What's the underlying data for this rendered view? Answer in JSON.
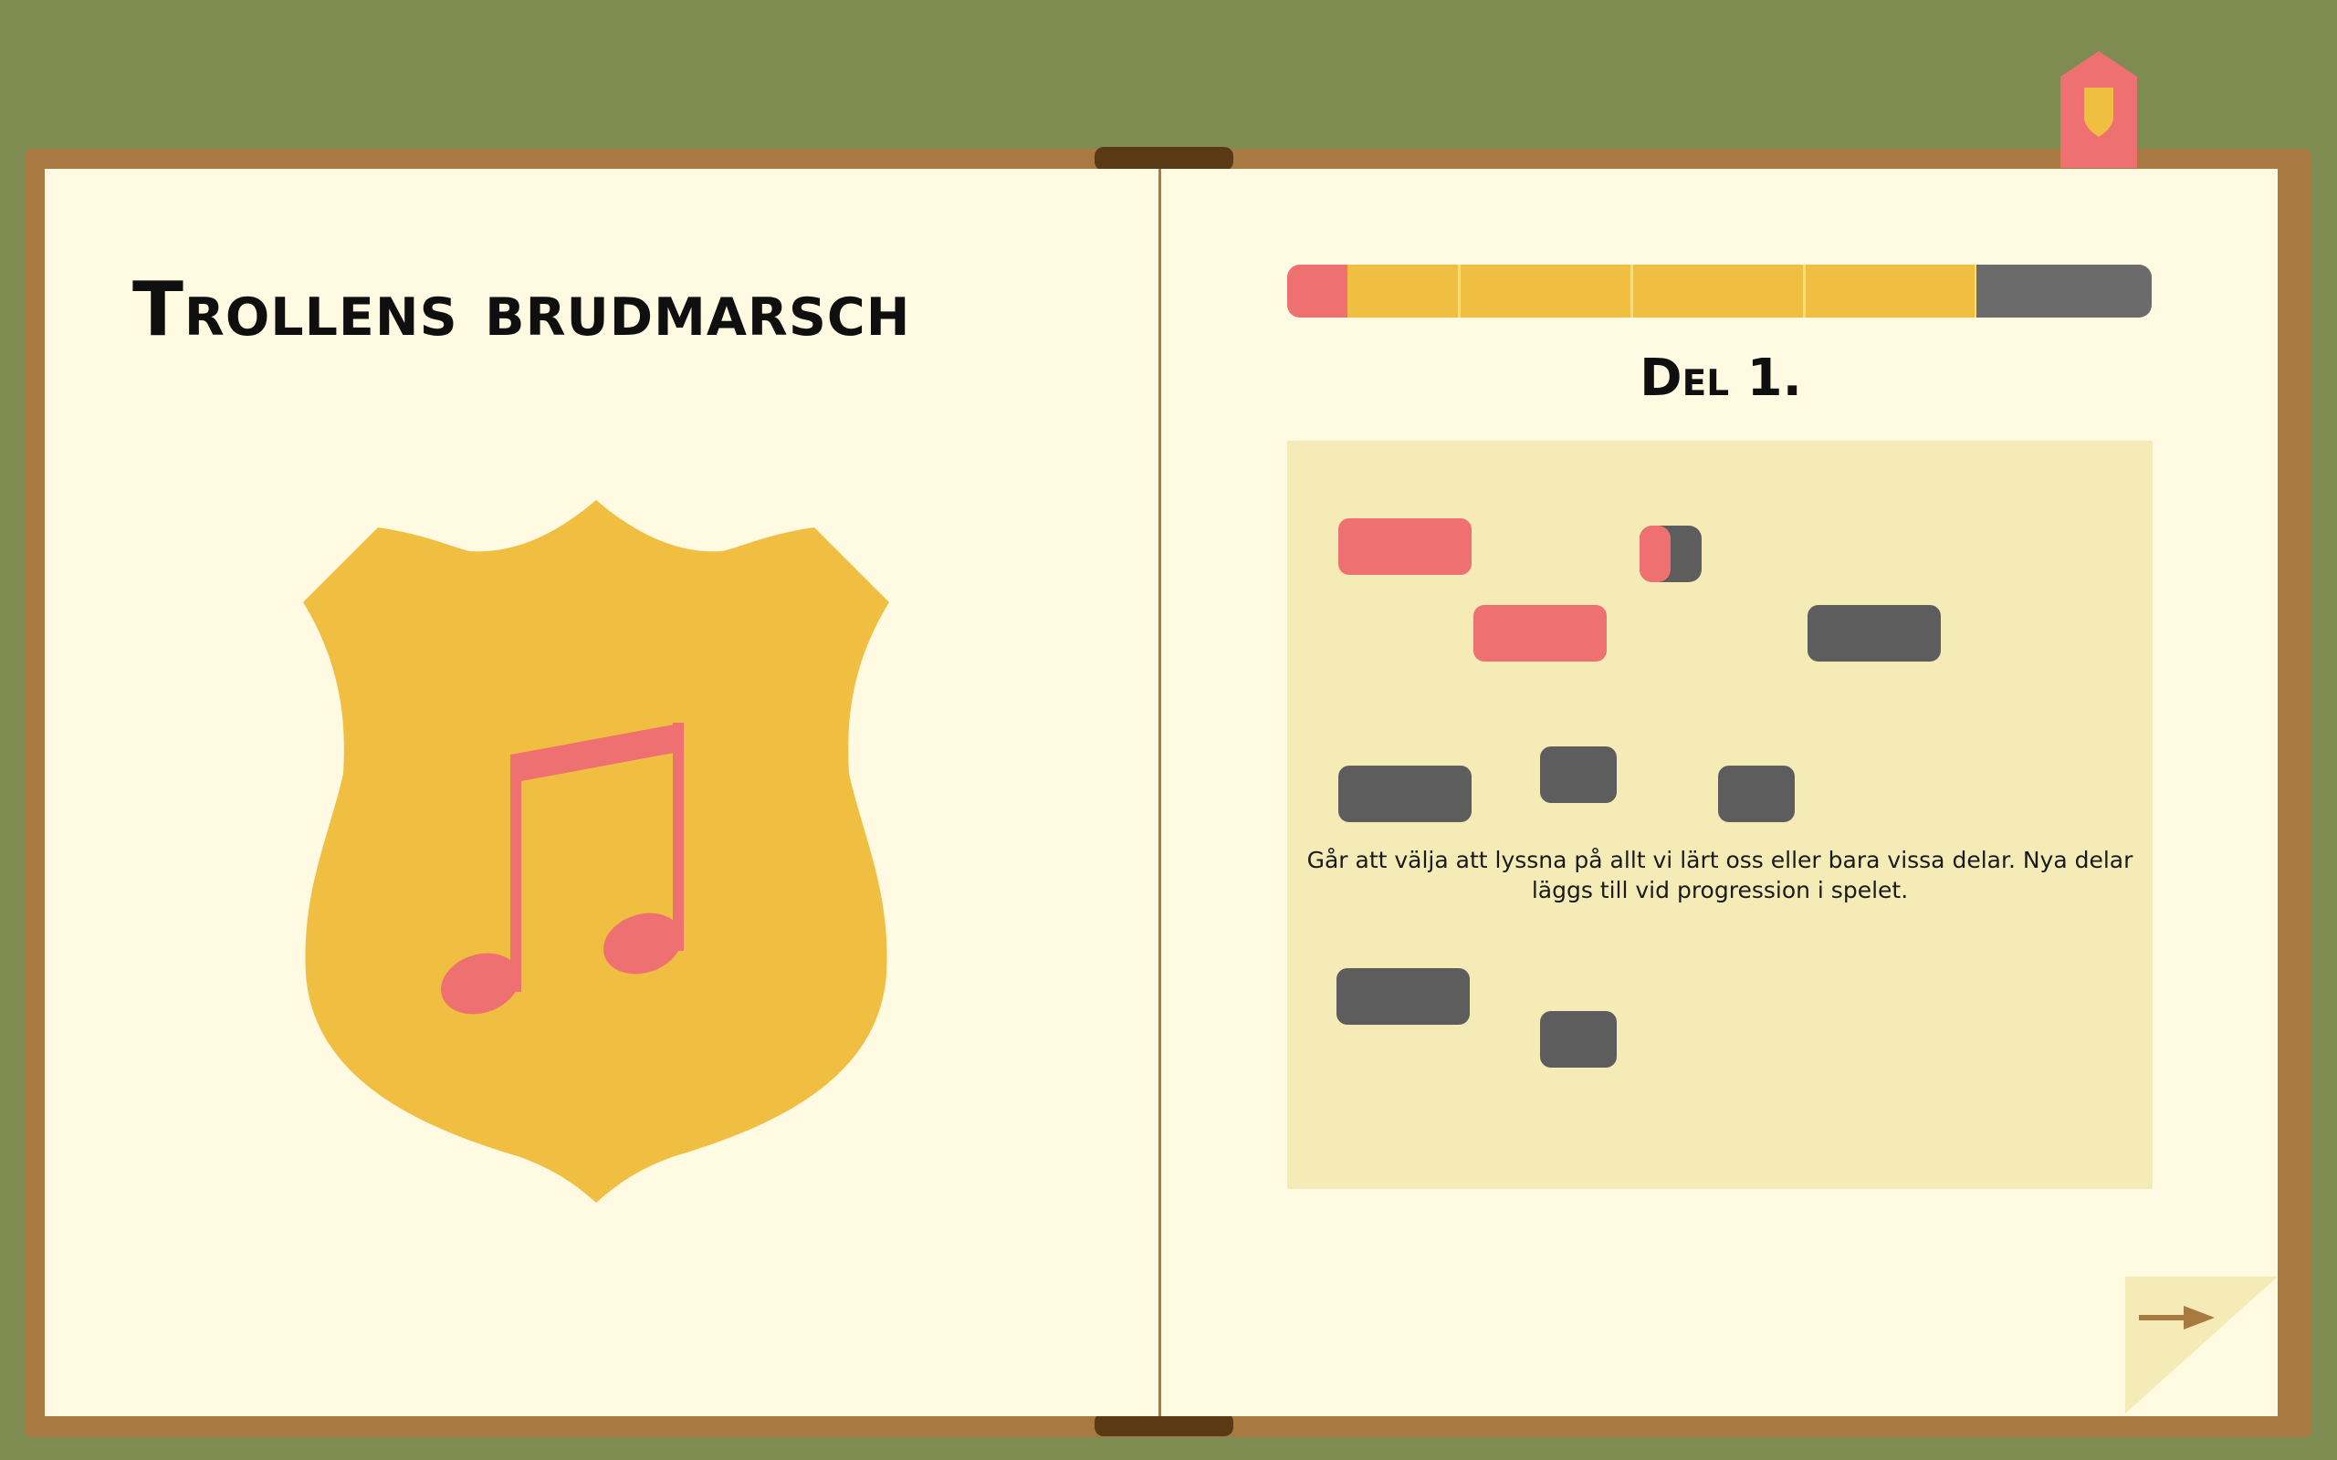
{
  "book": {
    "title": "Trollens brudmarsch",
    "badge_icon": "music-note-shield-icon"
  },
  "progress": {
    "value_fraction": 0.07,
    "segments": 4,
    "colors": {
      "done": "#ee7070",
      "pending": "#f0bf42",
      "locked": "#6b6b6b"
    }
  },
  "part": {
    "heading": "Del 1.",
    "description": "Går att välja att lyssna på allt vi lärt oss eller bara vissa delar. Nya delar läggs till vid progression i spelet."
  },
  "bookmark": {
    "icon": "shield-icon"
  },
  "navigation": {
    "next_icon": "arrow-right-icon"
  },
  "colors": {
    "background": "#7e8c51",
    "book_border": "#a87a42",
    "page": "#fffae1",
    "panel": "#f4ebb6",
    "shield": "#f0bf42",
    "accent": "#ee7070",
    "locked": "#5d5d5d"
  }
}
